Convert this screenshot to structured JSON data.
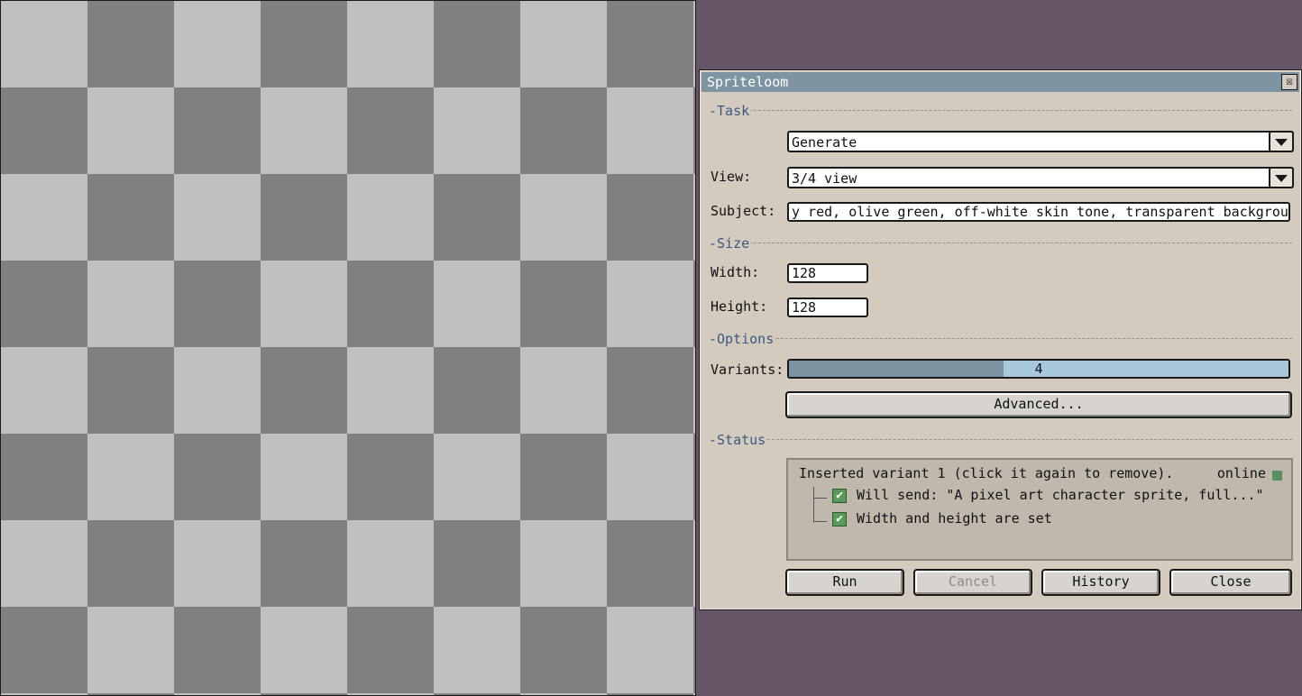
{
  "dialog": {
    "title": "Spriteloom",
    "close_glyph": "☒"
  },
  "task": {
    "section": "-Task",
    "mode_value": "Generate",
    "view_label": "View:",
    "view_value": "3/4 view",
    "subject_label": "Subject:",
    "subject_value": "y red, olive green, off-white skin tone, transparent background"
  },
  "size": {
    "section": "-Size",
    "width_label": "Width:",
    "width_value": "128",
    "height_label": "Height:",
    "height_value": "128"
  },
  "options": {
    "section": "-Options",
    "variants_label": "Variants:",
    "variants_value": "4",
    "variants_fill_fraction": 0.43,
    "advanced_label": "Advanced..."
  },
  "status": {
    "section": "-Status",
    "message": "Inserted variant 1 (click it again to remove).",
    "online_label": "online",
    "online_color": "#5a8f5f",
    "checks": [
      {
        "label": "Will send: \"A pixel art character sprite, full...\"",
        "checked": true
      },
      {
        "label": "Width and height are set",
        "checked": true
      }
    ]
  },
  "buttons": {
    "run": "Run",
    "cancel": "Cancel",
    "history": "History",
    "close": "Close"
  },
  "colors": {
    "desktop": "#655566",
    "dialog_bg": "#d4cabd",
    "titlebar": "#7d94a2",
    "section_text": "#3b5a86",
    "slider_track": "#a8c8dc",
    "slider_fill": "#7d94a2",
    "checker_dark": "#808080",
    "checker_light": "#c0c0c0"
  },
  "icons": {
    "close": "close-icon",
    "dropdown": "chevron-down-icon",
    "check": "checkmark-icon"
  }
}
